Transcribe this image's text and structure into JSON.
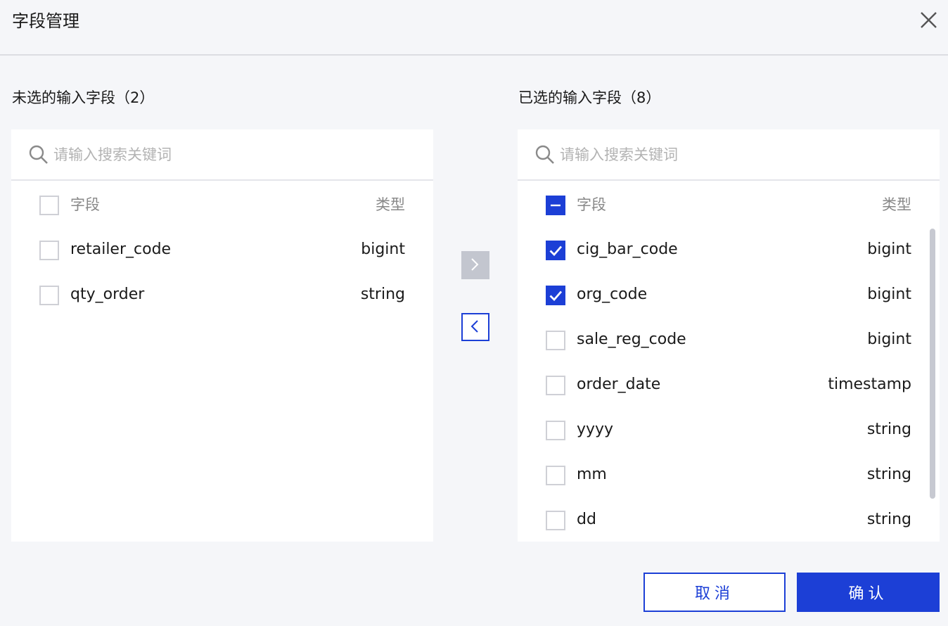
{
  "dialog": {
    "title": "字段管理",
    "close_icon": "close-icon"
  },
  "left_panel": {
    "label": "未选的输入字段（2）",
    "search_placeholder": "请输入搜索关键词",
    "header": {
      "field": "字段",
      "type": "类型",
      "checkbox_state": "unchecked"
    },
    "rows": [
      {
        "name": "retailer_code",
        "type": "bigint",
        "checked": false
      },
      {
        "name": "qty_order",
        "type": "string",
        "checked": false
      }
    ]
  },
  "right_panel": {
    "label": "已选的输入字段（8）",
    "search_placeholder": "请输入搜索关键词",
    "header": {
      "field": "字段",
      "type": "类型",
      "checkbox_state": "indeterminate"
    },
    "rows": [
      {
        "name": "cig_bar_code",
        "type": "bigint",
        "checked": true
      },
      {
        "name": "org_code",
        "type": "bigint",
        "checked": true
      },
      {
        "name": "sale_reg_code",
        "type": "bigint",
        "checked": false
      },
      {
        "name": "order_date",
        "type": "timestamp",
        "checked": false
      },
      {
        "name": "yyyy",
        "type": "string",
        "checked": false
      },
      {
        "name": "mm",
        "type": "string",
        "checked": false
      },
      {
        "name": "dd",
        "type": "string",
        "checked": false
      }
    ]
  },
  "transfer": {
    "move_right_icon": "chevron-right-icon",
    "move_left_icon": "chevron-left-icon",
    "move_right_enabled": false,
    "move_left_enabled": true
  },
  "footer": {
    "cancel_label": "取消",
    "confirm_label": "确认"
  },
  "colors": {
    "primary": "#1c3fd6",
    "disabled": "#c3c6cf",
    "background": "#f5f6f9",
    "panel": "#ffffff"
  }
}
